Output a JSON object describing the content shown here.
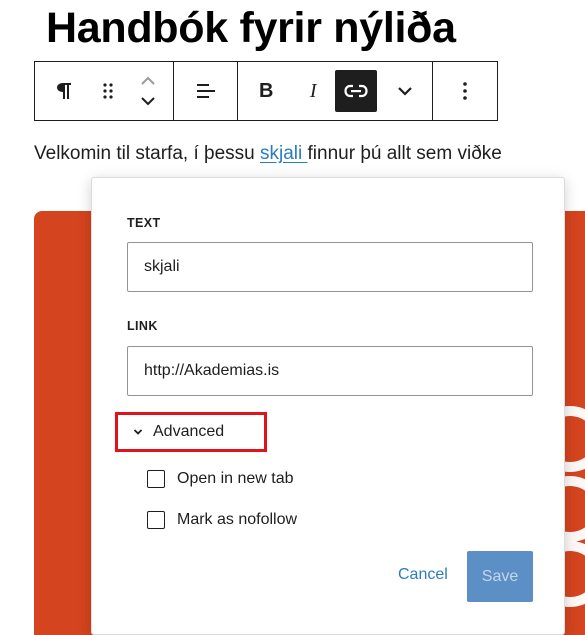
{
  "heading": {
    "text": "Handbók fyrir nýliða"
  },
  "toolbar": {
    "paragraph_icon": "pilcrow-icon",
    "drag_icon": "drag-handle-icon",
    "move_icon": "move-up-down-icon",
    "align_icon": "align-left-icon",
    "bold_label": "B",
    "italic_label": "I",
    "link_icon": "link-icon",
    "more_formats_icon": "chevron-down-icon",
    "options_icon": "more-vertical-icon"
  },
  "paragraph": {
    "before_link": "Velkomin til starfa, í þessu ",
    "link_text": "skjali ",
    "after_link": "finnur þú allt sem viðke"
  },
  "link_popover": {
    "text_label": "TEXT",
    "text_value": "skjali",
    "link_label": "LINK",
    "link_value": "http://Akademias.is",
    "advanced_label": "Advanced",
    "open_new_tab_label": "Open in new tab",
    "open_new_tab_checked": false,
    "nofollow_label": "Mark as nofollow",
    "nofollow_checked": false,
    "cancel_label": "Cancel",
    "save_label": "Save"
  },
  "colors": {
    "accent": "#2c7cc0",
    "highlight_box": "#e0121b",
    "image_background": "#d4441f",
    "save_button": "#5b8fc5"
  }
}
